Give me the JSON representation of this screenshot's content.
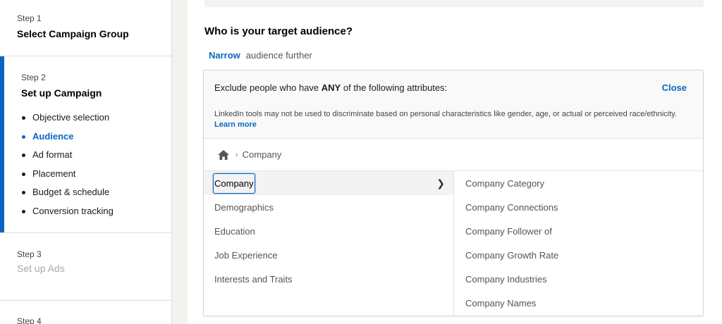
{
  "sidebar": {
    "steps": [
      {
        "number": "Step 1",
        "title": "Select Campaign Group"
      },
      {
        "number": "Step 2",
        "title": "Set up Campaign",
        "substeps": [
          "Objective selection",
          "Audience",
          "Ad format",
          "Placement",
          "Budget & schedule",
          "Conversion tracking"
        ],
        "active_substep": "Audience"
      },
      {
        "number": "Step 3",
        "title": "Set up Ads"
      },
      {
        "number": "Step 4",
        "title": ""
      }
    ]
  },
  "main": {
    "question": "Who is your target audience?",
    "narrow_link": "Narrow",
    "narrow_suffix": "audience further",
    "exclude": {
      "prefix": "Exclude people who have ",
      "emphasis": "ANY",
      "suffix": " of the following attributes:",
      "close_label": "Close",
      "disclaimer": "LinkedIn tools may not be used to discriminate based on personal characteristics like gender, age, or actual or perceived race/ethnicity.",
      "learn_more": "Learn more"
    },
    "breadcrumb": {
      "home_icon": "home-icon",
      "current": "Company"
    },
    "categories": [
      "Company",
      "Demographics",
      "Education",
      "Job Experience",
      "Interests and Traits"
    ],
    "selected_category": "Company",
    "subcategories": [
      "Company Category",
      "Company Connections",
      "Company Follower of",
      "Company Growth Rate",
      "Company Industries",
      "Company Names"
    ]
  },
  "colors": {
    "accent": "#0a66c2"
  }
}
